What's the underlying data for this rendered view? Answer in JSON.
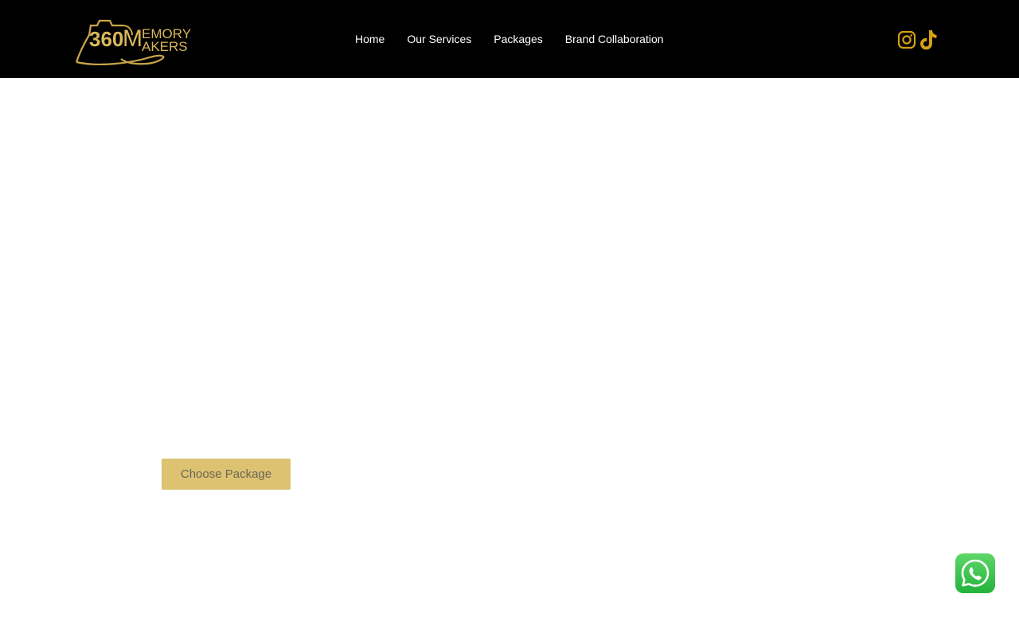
{
  "brand": {
    "logo_text_main": "360",
    "logo_text_line1": "EMORY",
    "logo_text_line2": "AKERS",
    "logo_letter": "M",
    "accent_color": "#d9b75c"
  },
  "nav": {
    "items": [
      {
        "label": "Home"
      },
      {
        "label": "Our Services"
      },
      {
        "label": "Packages"
      },
      {
        "label": "Brand Collaboration"
      }
    ]
  },
  "social": {
    "icons": [
      "instagram-icon",
      "tiktok-icon"
    ],
    "color": "#d4a017"
  },
  "hero": {
    "cta_label": "Choose Package",
    "cta_color": "#dcc271"
  },
  "chat_widget": {
    "icon": "whatsapp-icon",
    "color": "#25d366"
  }
}
